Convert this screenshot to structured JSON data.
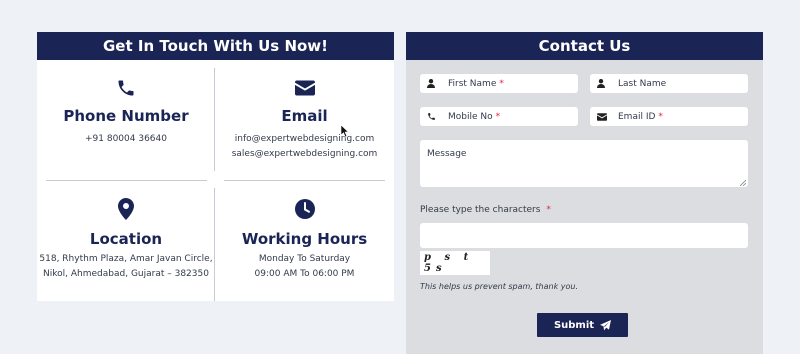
{
  "contact_info": {
    "heading": "Get In Touch With Us Now!",
    "phone": {
      "icon": "phone-icon",
      "title": "Phone Number",
      "lines": [
        "+91 80004 36640"
      ]
    },
    "email": {
      "icon": "envelope-icon",
      "title": "Email",
      "lines": [
        "info@expertwebdesigning.com",
        "sales@expertwebdesigning.com"
      ]
    },
    "location": {
      "icon": "map-pin-icon",
      "title": "Location",
      "lines": [
        "518, Rhythm Plaza, Amar Javan Circle,",
        "Nikol, Ahmedabad, Gujarat – 382350"
      ]
    },
    "hours": {
      "icon": "clock-icon",
      "title": "Working Hours",
      "lines": [
        "Monday To Saturday",
        "09:00 AM To 06:00 PM"
      ]
    }
  },
  "contact_form": {
    "heading": "Contact Us",
    "first_name": {
      "placeholder": "First Name",
      "required_mark": "*",
      "icon": "user-icon"
    },
    "last_name": {
      "placeholder": "Last Name",
      "icon": "user-icon"
    },
    "mobile": {
      "placeholder": "Mobile No",
      "required_mark": "*",
      "icon": "phone-icon"
    },
    "email": {
      "placeholder": "Email ID",
      "required_mark": "*",
      "icon": "envelope-icon"
    },
    "message": {
      "placeholder": "Message"
    },
    "captcha_label": "Please type the characters",
    "captcha_required_mark": "*",
    "captcha_text": "p s t 5s",
    "captcha_note": "This helps us prevent spam, thank you.",
    "submit_label": "Submit",
    "submit_icon": "paper-plane-icon"
  },
  "colors": {
    "navy": "#1a2455",
    "required": "#e0263a",
    "page_bg": "#eef1f5",
    "form_bg": "#dcdde0"
  }
}
